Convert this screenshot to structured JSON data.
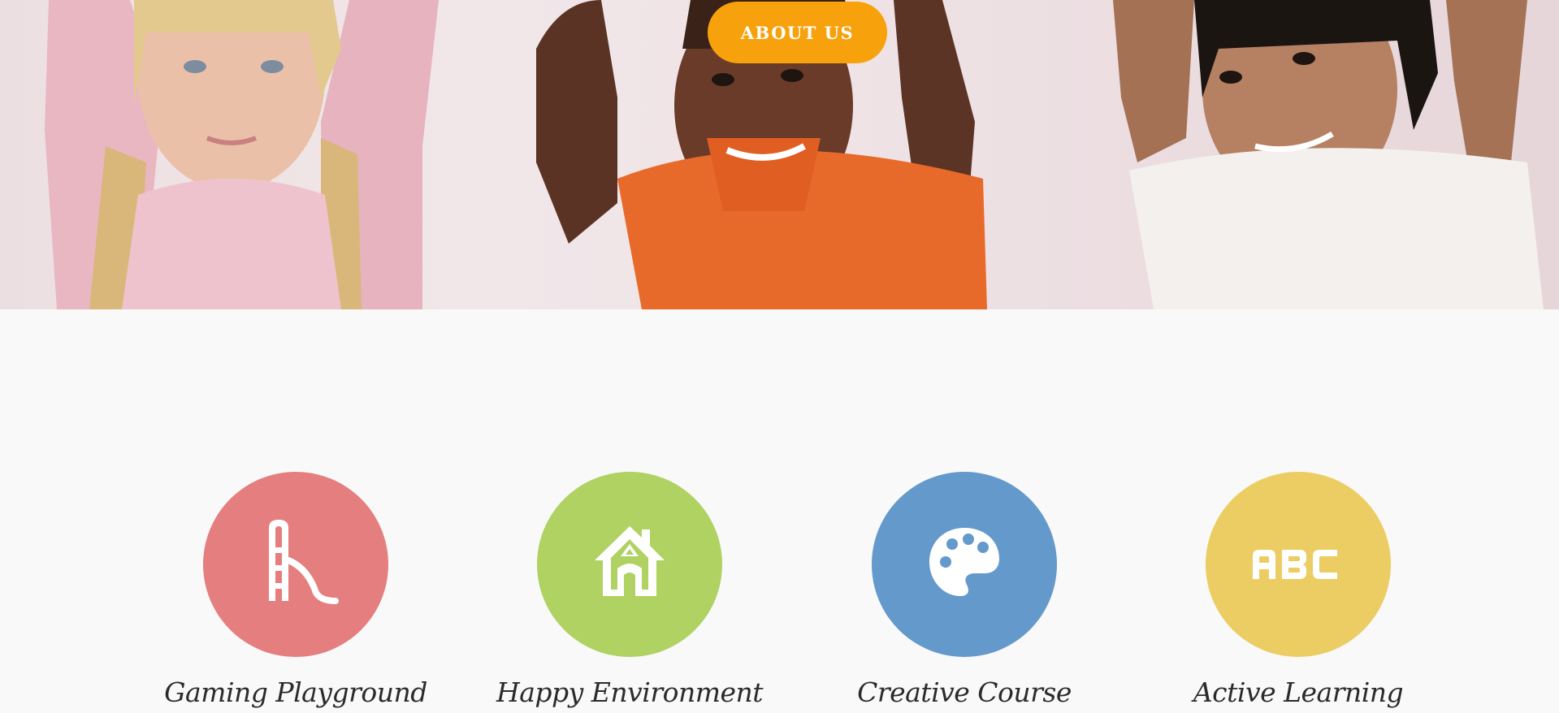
{
  "hero": {
    "button_label": "ABOUT US",
    "button_color": "#f7a20c"
  },
  "features": [
    {
      "title": "Gaming Playground",
      "icon": "slide-icon",
      "color": "#e57e7f"
    },
    {
      "title": "Happy Environment",
      "icon": "house-icon",
      "color": "#afd262"
    },
    {
      "title": "Creative Course",
      "icon": "palette-icon",
      "color": "#6499cb"
    },
    {
      "title": "Active Learning",
      "icon": "abc-icon",
      "color": "#eccd63"
    }
  ]
}
